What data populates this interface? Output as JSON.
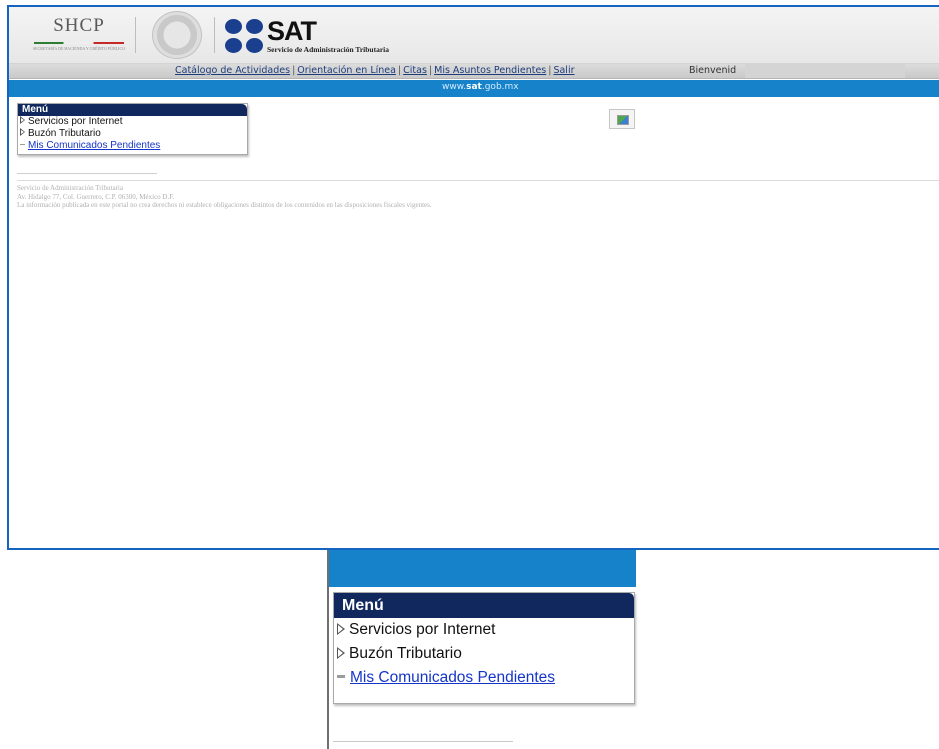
{
  "header": {
    "shcp_title": "SHCP",
    "shcp_subtitle": "SECRETARÍA DE HACIENDA Y CRÉDITO PÚBLICO",
    "sat_title": "SAT",
    "sat_subtitle": "Servicio de Administración Tributaria"
  },
  "nav": {
    "links": [
      "Catálogo de Actividades",
      "Orientación en Línea",
      "Citas",
      "Mis Asuntos Pendientes",
      "Salir"
    ],
    "welcome": "Bienvenid",
    "url_prefix": "www.",
    "url_bold": "sat",
    "url_suffix": ".gob.mx"
  },
  "menu": {
    "title": "Menú",
    "items": [
      {
        "label": "Servicios por Internet",
        "type": "expandable"
      },
      {
        "label": "Buzón Tributario",
        "type": "expandable"
      },
      {
        "label": "Mis Comunicados Pendientes",
        "type": "link"
      }
    ]
  },
  "footer": {
    "line1": "Servicio de Administración Tributaria",
    "line2": "Av. Hidalgo 77, Col. Guerrero, C.P. 06300, México D.F.",
    "line3": "La información publicada en este portal no crea derechos ni establece obligaciones distintos de los contenidos en las disposiciones fiscales vigentes."
  },
  "colors": {
    "brand_blue": "#1582c9",
    "menu_header": "#10285e",
    "link": "#1535c9"
  }
}
